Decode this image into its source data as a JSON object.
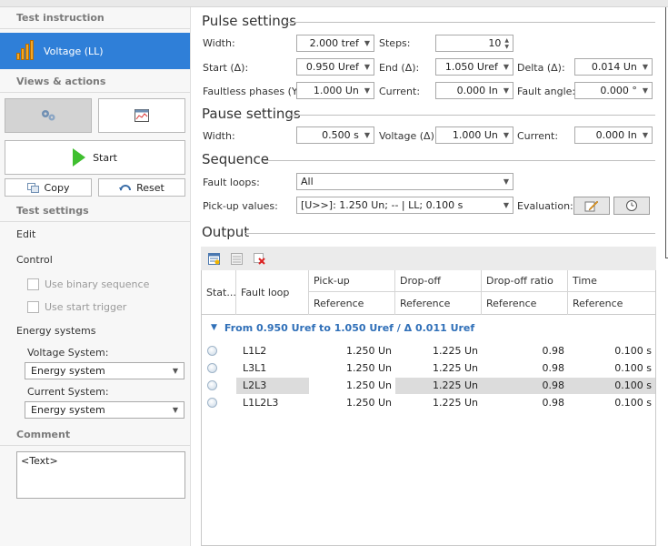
{
  "left": {
    "test_instruction_header": "Test instruction",
    "selected_instruction": "Voltage (LL)",
    "views_header": "Views & actions",
    "start_label": "Start",
    "copy_label": "Copy",
    "reset_label": "Reset",
    "test_settings_header": "Test settings",
    "edit_label": "Edit",
    "control_label": "Control",
    "use_binary_sequence": "Use binary sequence",
    "use_start_trigger": "Use start trigger",
    "energy_systems_label": "Energy systems",
    "voltage_system_label": "Voltage System:",
    "voltage_system_value": "Energy system",
    "current_system_label": "Current System:",
    "current_system_value": "Energy system",
    "comment_header": "Comment",
    "comment_text": "<Text>"
  },
  "pulse": {
    "title": "Pulse settings",
    "width_label": "Width:",
    "width_value": "2.000 tref",
    "steps_label": "Steps:",
    "steps_value": "10",
    "start_label": "Start (Δ):",
    "start_value": "0.950 Uref",
    "end_label": "End (Δ):",
    "end_value": "1.050 Uref",
    "delta_label": "Delta (Δ):",
    "delta_value": "0.014 Un",
    "faultless_label": "Faultless phases (Y):",
    "faultless_value": "1.000 Un",
    "current_label": "Current:",
    "current_value": "0.000 In",
    "fault_angle_label": "Fault angle:",
    "fault_angle_value": "0.000 °"
  },
  "pause": {
    "title": "Pause settings",
    "width_label": "Width:",
    "width_value": "0.500 s",
    "voltage_label": "Voltage (Δ):",
    "voltage_value": "1.000 Un",
    "current_label": "Current:",
    "current_value": "0.000 In"
  },
  "sequence": {
    "title": "Sequence",
    "fault_loops_label": "Fault loops:",
    "fault_loops_value": "All",
    "pickup_label": "Pick-up values:",
    "pickup_value": "[U>>]: 1.250 Un; -- | LL; 0.100 s",
    "evaluation_label": "Evaluation:"
  },
  "output": {
    "title": "Output",
    "headers": {
      "status": "Stat...",
      "fault_loop": "Fault loop",
      "pickup": "Pick-up",
      "dropoff": "Drop-off",
      "ratio": "Drop-off ratio",
      "time": "Time",
      "reference": "Reference"
    },
    "group_label": "From 0.950 Uref to 1.050 Uref / Δ 0.011 Uref",
    "rows": [
      {
        "loop": "L1L2",
        "pickup": "1.250 Un",
        "dropoff": "1.225 Un",
        "ratio": "0.98",
        "time": "0.100 s"
      },
      {
        "loop": "L3L1",
        "pickup": "1.250 Un",
        "dropoff": "1.225 Un",
        "ratio": "0.98",
        "time": "0.100 s"
      },
      {
        "loop": "L2L3",
        "pickup": "1.250 Un",
        "dropoff": "1.225 Un",
        "ratio": "0.98",
        "time": "0.100 s"
      },
      {
        "loop": "L1L2L3",
        "pickup": "1.250 Un",
        "dropoff": "1.225 Un",
        "ratio": "0.98",
        "time": "0.100 s"
      }
    ]
  }
}
